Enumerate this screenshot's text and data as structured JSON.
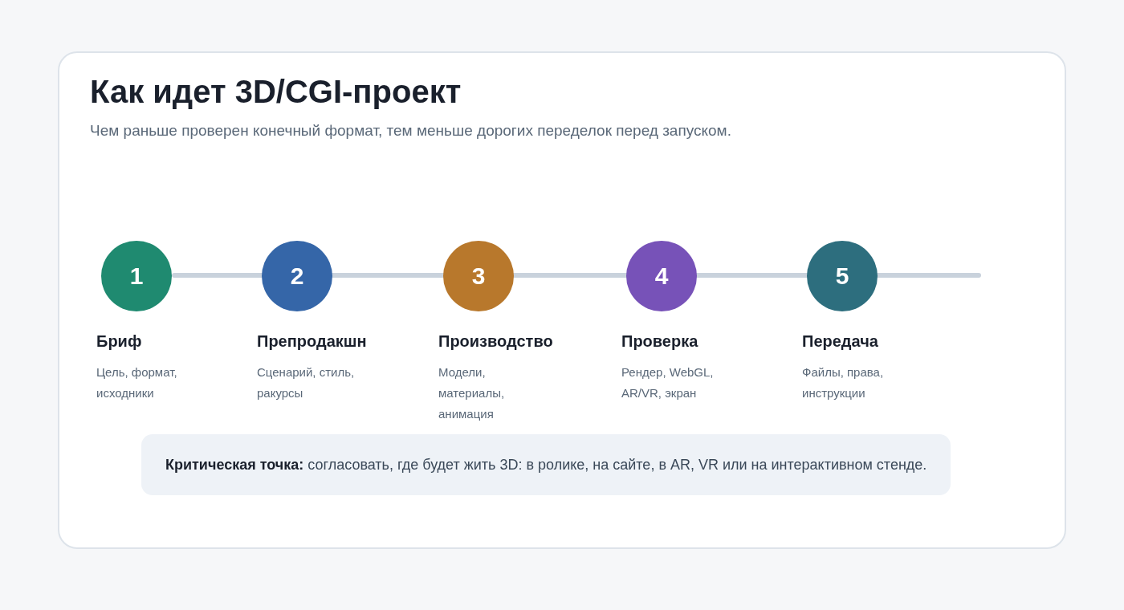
{
  "title": "Как идет 3D/CGI-проект",
  "subtitle": "Чем раньше проверен конечный формат, тем меньше дорогих переделок перед запуском.",
  "steps": [
    {
      "number": "1",
      "title": "Бриф",
      "description": "Цель, формат, исходники",
      "color": "#1f8a70"
    },
    {
      "number": "2",
      "title": "Препродакшн",
      "description": "Сценарий, стиль, ракурсы",
      "color": "#3566a8"
    },
    {
      "number": "3",
      "title": "Производство",
      "description": "Модели, материалы, анимация",
      "color": "#b8782c"
    },
    {
      "number": "4",
      "title": "Проверка",
      "description": "Рендер, WebGL, AR/VR, экран",
      "color": "#7752b8"
    },
    {
      "number": "5",
      "title": "Передача",
      "description": "Файлы, права, инструкции",
      "color": "#2d6e7e"
    }
  ],
  "callout": "**Критическая точка:** согласовать, где будет жить 3D: в ролике, на сайте, в AR, VR или на интерактивном стенде."
}
